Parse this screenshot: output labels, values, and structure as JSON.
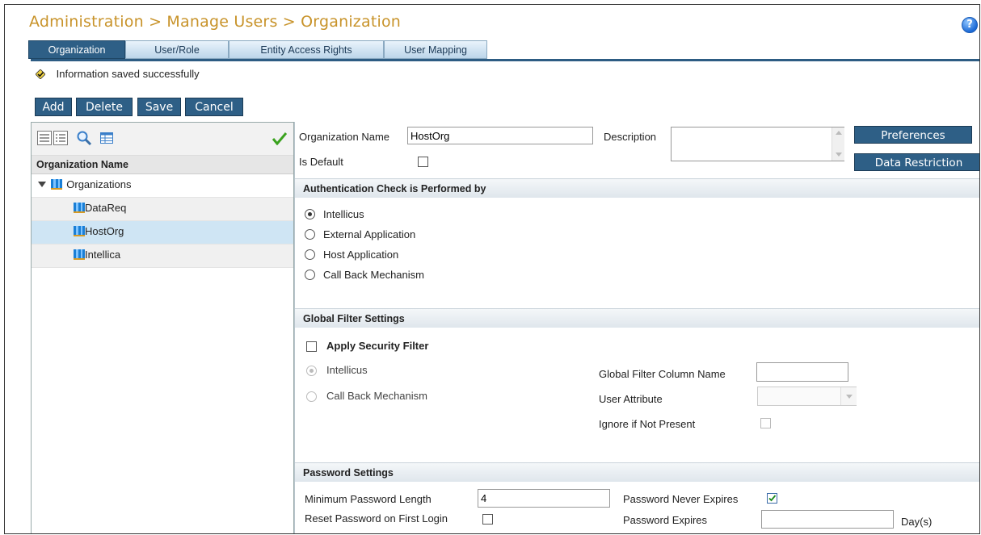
{
  "header": {
    "title": "Administration > Manage Users > Organization",
    "help": "?"
  },
  "tabs": [
    {
      "label": "Organization"
    },
    {
      "label": "User/Role"
    },
    {
      "label": "Entity Access Rights"
    },
    {
      "label": "User Mapping"
    }
  ],
  "message": "Information saved successfully",
  "toolbar": {
    "add": "Add",
    "delete": "Delete",
    "save": "Save",
    "cancel": "Cancel"
  },
  "left_pane": {
    "column_header": "Organization Name",
    "root": "Organizations",
    "items": [
      {
        "label": "DataReq"
      },
      {
        "label": "HostOrg"
      },
      {
        "label": "Intellica"
      }
    ],
    "selected": "HostOrg"
  },
  "form": {
    "org_name_label": "Organization Name",
    "org_name_value": "HostOrg",
    "description_label": "Description",
    "description_value": "",
    "is_default_label": "Is Default",
    "is_default_checked": false,
    "preferences_button": "Preferences",
    "data_restriction_button": "Data Restriction"
  },
  "auth": {
    "header": "Authentication Check is Performed by",
    "options": [
      {
        "label": "Intellicus",
        "selected": true
      },
      {
        "label": "External Application",
        "selected": false
      },
      {
        "label": "Host Application",
        "selected": false
      },
      {
        "label": "Call Back Mechanism",
        "selected": false
      }
    ]
  },
  "global_filter": {
    "header": "Global Filter Settings",
    "apply_label": "Apply Security Filter",
    "apply_checked": false,
    "option_intellicus": "Intellicus",
    "option_callback": "Call Back Mechanism",
    "column_name_label": "Global Filter Column Name",
    "column_name_value": "",
    "user_attribute_label": "User Attribute",
    "user_attribute_value": "",
    "ignore_label": "Ignore if Not Present"
  },
  "password": {
    "header": "Password Settings",
    "min_length_label": "Minimum Password Length",
    "min_length_value": "4",
    "never_expires_label": "Password Never Expires",
    "never_expires_checked": true,
    "reset_label": "Reset Password on First Login",
    "reset_checked": false,
    "expires_label": "Password Expires",
    "expires_value": "",
    "days_label": "Day(s)"
  },
  "colors": {
    "accent": "#2e5f86",
    "title": "#c8932a",
    "selected_row": "#cfe5f4"
  }
}
